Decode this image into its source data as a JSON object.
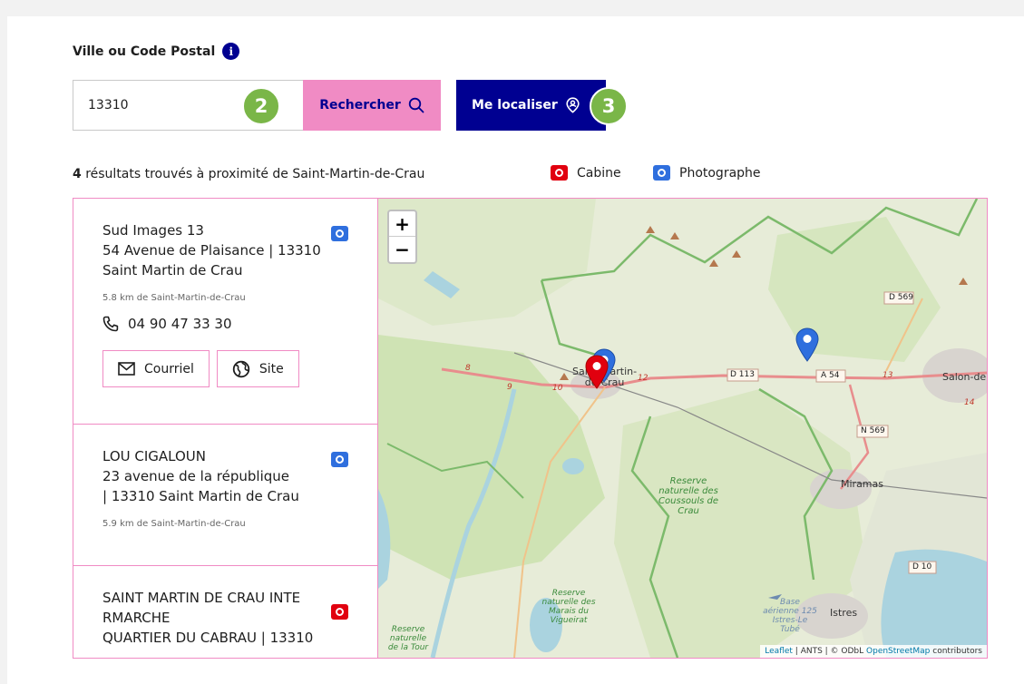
{
  "form": {
    "label": "Ville ou Code Postal",
    "input_value": "13310",
    "search_label": "Rechercher",
    "locate_label": "Me localiser",
    "badge_2": "2",
    "badge_3": "3"
  },
  "results": {
    "count": "4",
    "summary": "résultats trouvés à proximité de Saint-Martin-de-Crau"
  },
  "legend": {
    "cabine": "Cabine",
    "photographe": "Photographe"
  },
  "items": [
    {
      "name": "Sud Images 13",
      "address": "54 Avenue de Plaisance  | 13310 Saint Martin de Crau",
      "distance": "5.8 km de Saint-Martin-de-Crau",
      "phone": "04 90 47 33 30",
      "email_label": "Courriel",
      "site_label": "Site",
      "type": "photographe"
    },
    {
      "name": "LOU CIGALOUN",
      "address": "23 avenue de la république\n | 13310 Saint Martin de Crau",
      "distance": "5.9 km de Saint-Martin-de-Crau",
      "type": "photographe"
    },
    {
      "name": "SAINT MARTIN DE CRAU INTE RMARCHE",
      "address": "QUARTIER DU CABRAU  | 13310",
      "type": "cabine"
    }
  ],
  "map": {
    "zoom_in": "+",
    "zoom_out": "−",
    "labels": {
      "town": "Saint-Martin-de-Crau",
      "town_line1": "Saint-Martin-",
      "town_line2": "de-Crau",
      "salon": "Salon-de",
      "miramas": "Miramas",
      "istres": "Istres",
      "reserve_coussouls": "Reserve naturelle des Coussouls de Crau",
      "reserve_marais": "Reserve naturelle des Marais du Vigueirat",
      "reserve_tour": "Reserve naturelle de la Tour",
      "base": "Base aérienne 125 Istres-Le Tubé"
    },
    "roads": [
      "D 569",
      "D 113",
      "A 54",
      "N 569",
      "D 10"
    ],
    "road_numbers": [
      "8",
      "9",
      "10",
      "12",
      "13",
      "14"
    ],
    "attribution_leaflet": "Leaflet",
    "attribution_mid": " | ANTS | © ODbL ",
    "attribution_osm": "OpenStreetMap",
    "attribution_end": " contributors"
  },
  "colors": {
    "primary": "#000091",
    "pink": "#f08bc4",
    "badge": "#7ab648",
    "cabine": "#e1000f",
    "photographe": "#2f6fde"
  }
}
